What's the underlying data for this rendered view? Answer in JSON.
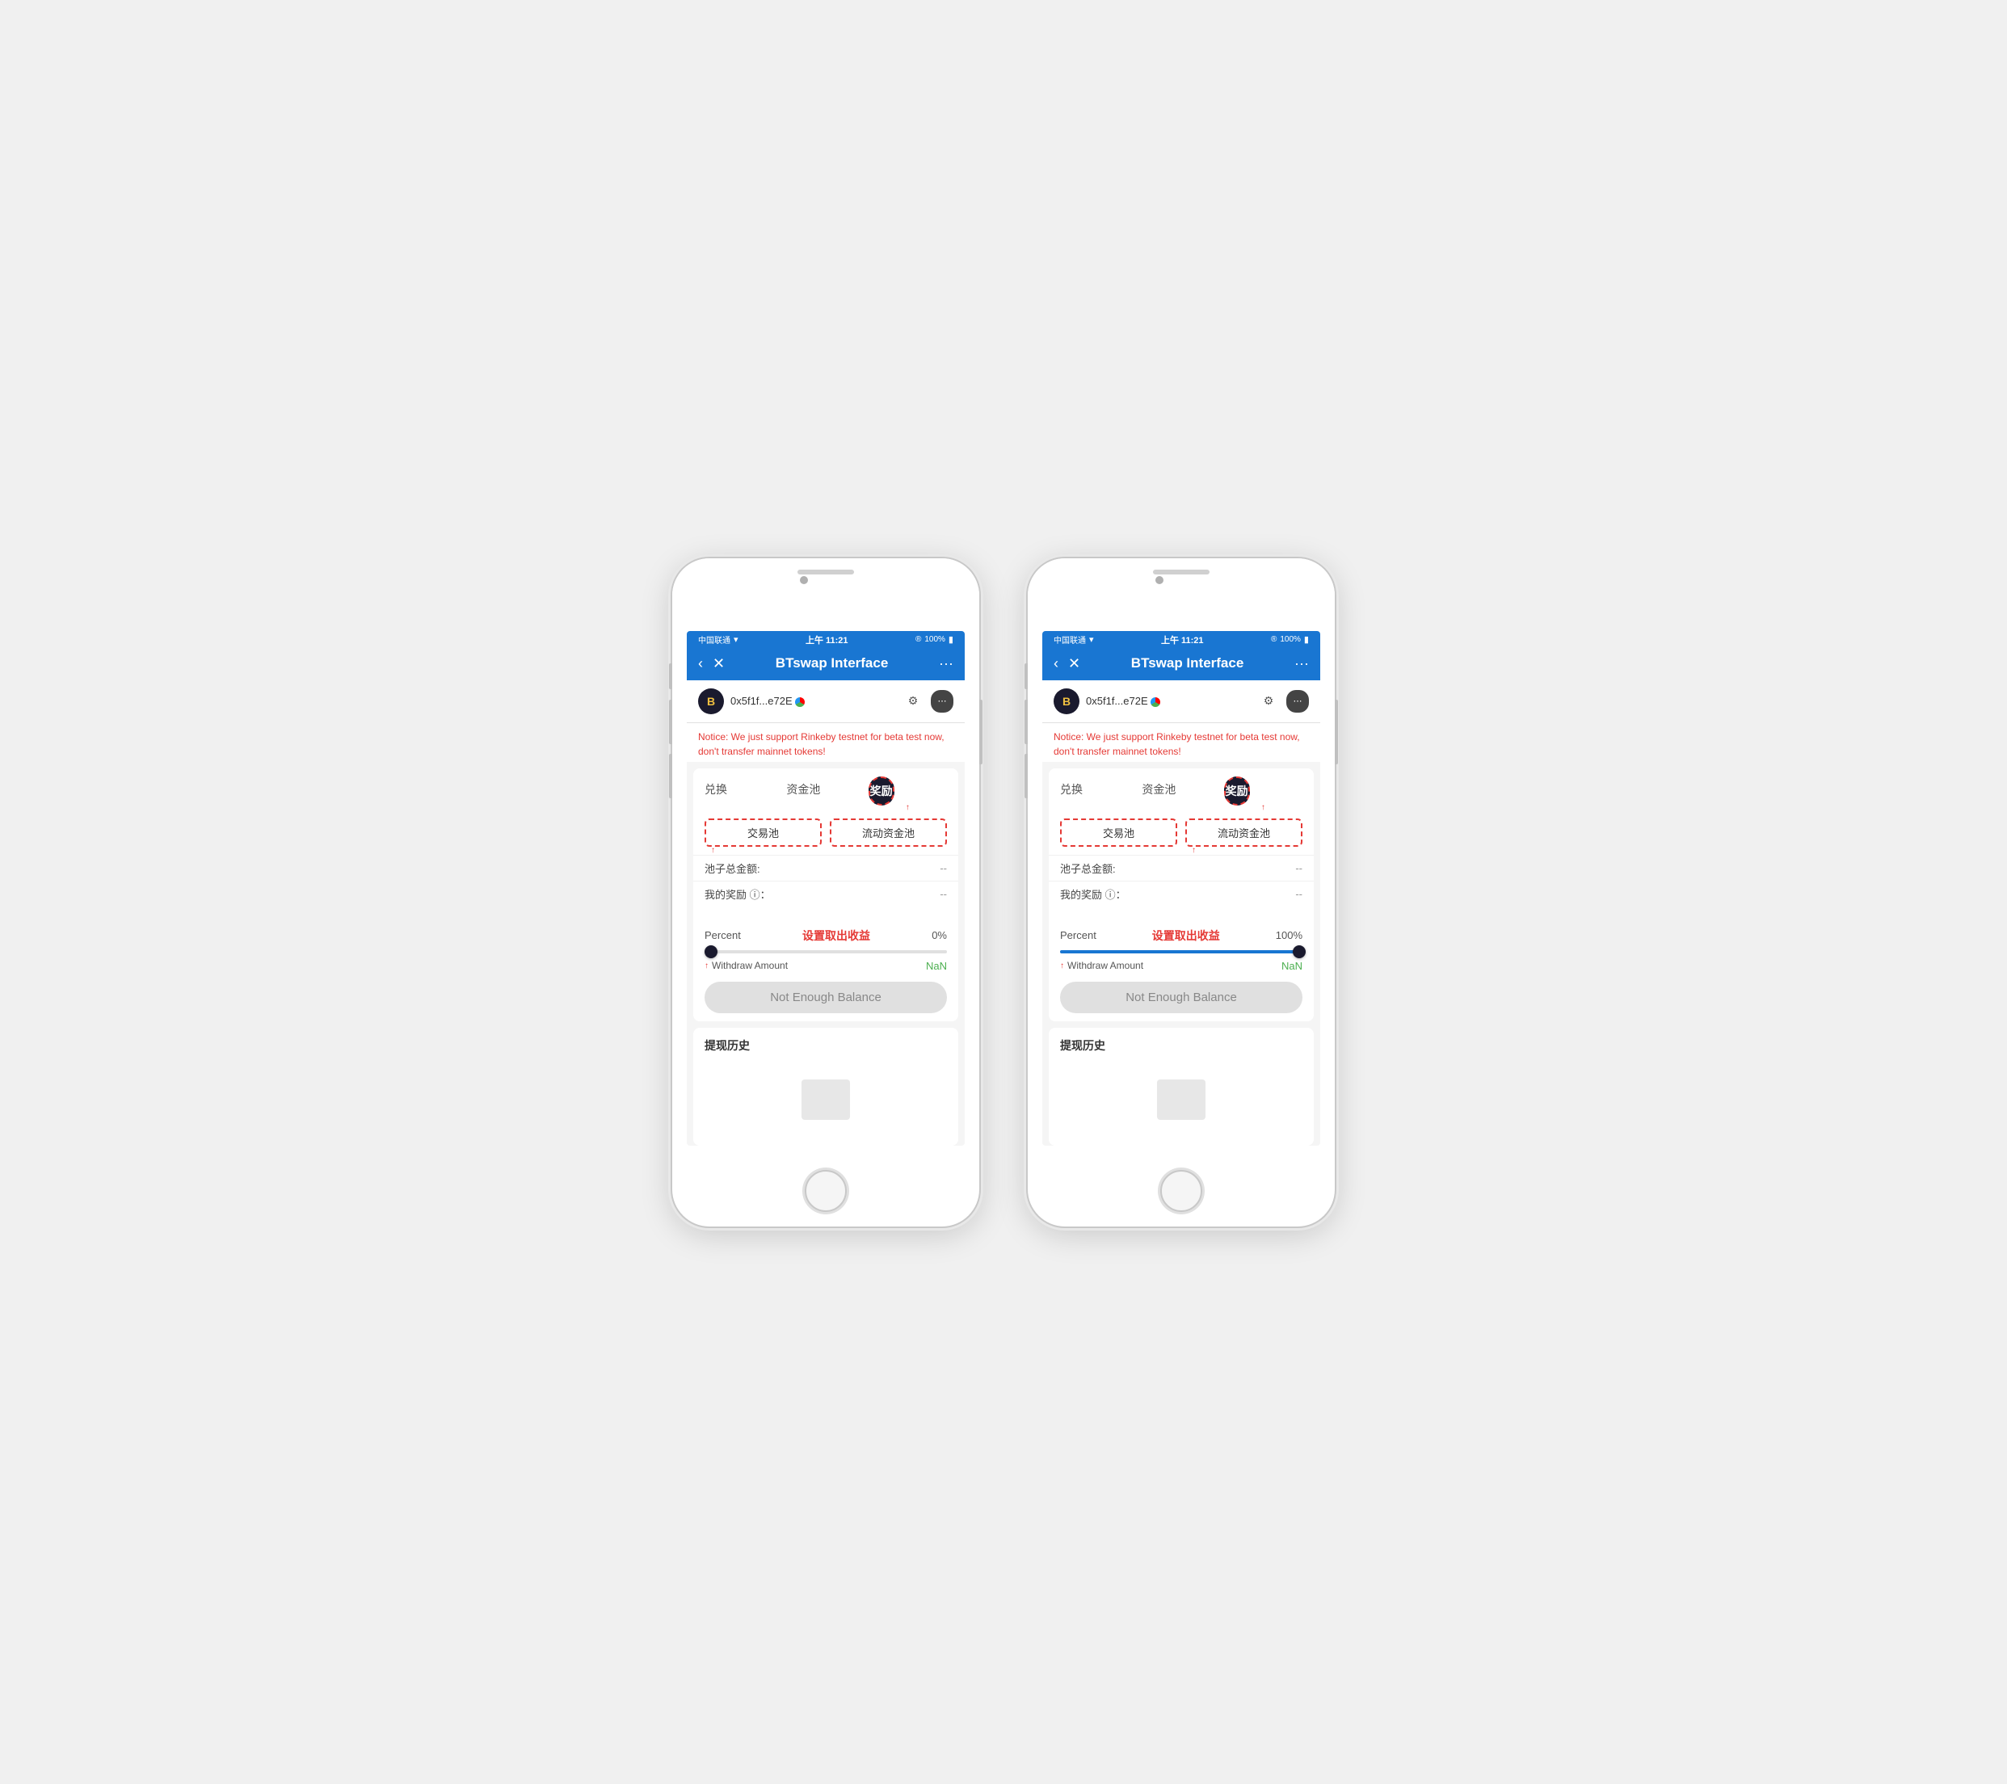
{
  "phones": [
    {
      "id": "phone-left",
      "status": {
        "carrier": "中国联通",
        "wifi": "WiFi",
        "time": "上午 11:21",
        "signal_icon": "®",
        "battery": "100%"
      },
      "nav": {
        "title": "BTswap Interface",
        "back_label": "‹",
        "close_label": "✕",
        "more_label": "···"
      },
      "address": {
        "text": "0x5f1f...e72E",
        "logo_label": "B",
        "gear_label": "⚙",
        "menu_label": "⋯"
      },
      "notice": "Notice: We just support Rinkeby testnet for beta test\nnow, don't transfer mainnet tokens!",
      "tabs": [
        "兑换",
        "资金池",
        "奖励"
      ],
      "active_tab": 2,
      "sub_tabs": [
        "交易池",
        "流动资金池"
      ],
      "active_sub_tab": 0,
      "active_sub_tab_dashed": 0,
      "tab_dashed": 2,
      "pool_total_label": "池子总金额:",
      "pool_total_value": "--",
      "my_reward_label": "我的奖励 ⓘ：",
      "my_reward_value": "--",
      "percent_label": "Percent",
      "percent_annotation": "设置取出收益",
      "percent_value": "0%",
      "slider_fill_pct": 0,
      "thumb_pct": 0,
      "withdraw_label": "Withdraw Amount",
      "withdraw_value": "NaN",
      "not_enough_label": "Not Enough Balance",
      "history_title": "提现历史",
      "arrow_left_tab": true,
      "arrow_left_slider": true
    },
    {
      "id": "phone-right",
      "status": {
        "carrier": "中国联通",
        "wifi": "WiFi",
        "time": "上午 11:21",
        "signal_icon": "®",
        "battery": "100%"
      },
      "nav": {
        "title": "BTswap Interface",
        "back_label": "‹",
        "close_label": "✕",
        "more_label": "···"
      },
      "address": {
        "text": "0x5f1f...e72E",
        "logo_label": "B",
        "gear_label": "⚙",
        "menu_label": "⋯"
      },
      "notice": "Notice: We just support Rinkeby testnet for beta test\nnow, don't transfer mainnet tokens!",
      "tabs": [
        "兑换",
        "资金池",
        "奖励"
      ],
      "active_tab": 2,
      "sub_tabs": [
        "交易池",
        "流动资金池"
      ],
      "active_sub_tab": 1,
      "active_sub_tab_dashed": 1,
      "tab_dashed": 2,
      "pool_total_label": "池子总金额:",
      "pool_total_value": "--",
      "my_reward_label": "我的奖励 ⓘ：",
      "my_reward_value": "--",
      "percent_label": "Percent",
      "percent_annotation": "设置取出收益",
      "percent_value": "100%",
      "slider_fill_pct": 100,
      "thumb_pct": 96,
      "withdraw_label": "Withdraw Amount",
      "withdraw_value": "NaN",
      "not_enough_label": "Not Enough Balance",
      "history_title": "提现历史",
      "arrow_left_tab": false,
      "arrow_left_slider": true
    }
  ]
}
